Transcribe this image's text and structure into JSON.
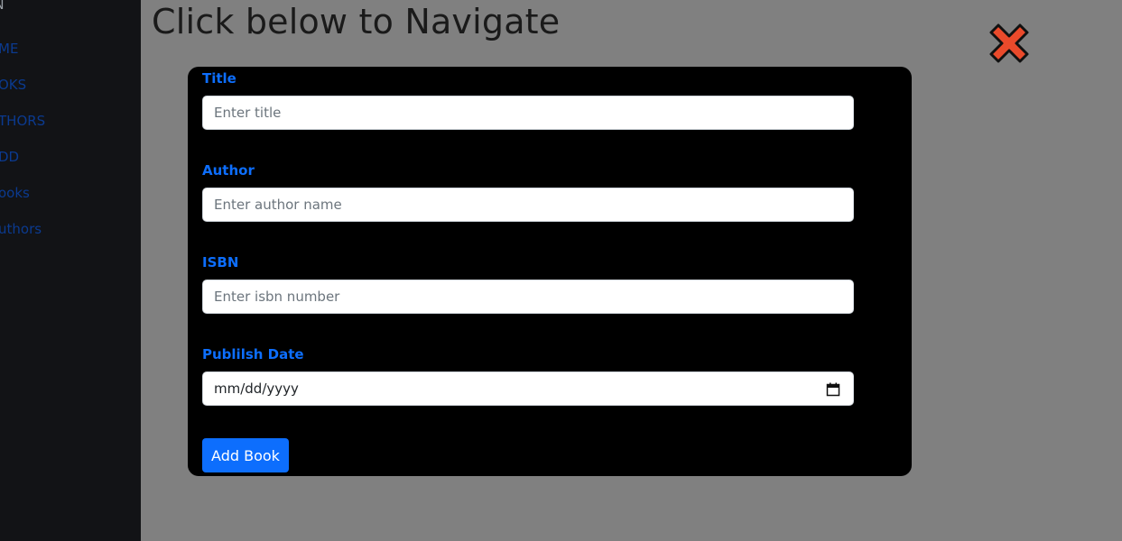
{
  "sidebar": {
    "brand": "N",
    "items": [
      {
        "label": "ME"
      },
      {
        "label": "OKS"
      },
      {
        "label": "THORS"
      },
      {
        "label": "DD"
      },
      {
        "label": "ooks"
      },
      {
        "label": "uthors"
      }
    ]
  },
  "main": {
    "title": "Click below to Navigate"
  },
  "modal": {
    "fields": [
      {
        "label": "Title",
        "placeholder": "Enter title"
      },
      {
        "label": "Author",
        "placeholder": "Enter author name"
      },
      {
        "label": "ISBN",
        "placeholder": "Enter isbn number"
      },
      {
        "label": "Publilsh Date",
        "value": "mm/dd/yyyy"
      }
    ],
    "submit_label": "Add Book"
  },
  "colors": {
    "accent": "#0d6efd",
    "close_icon": "#ea4a2b",
    "overlay": "#808080"
  },
  "icons": {
    "close": "close-icon",
    "calendar": "calendar-icon"
  }
}
